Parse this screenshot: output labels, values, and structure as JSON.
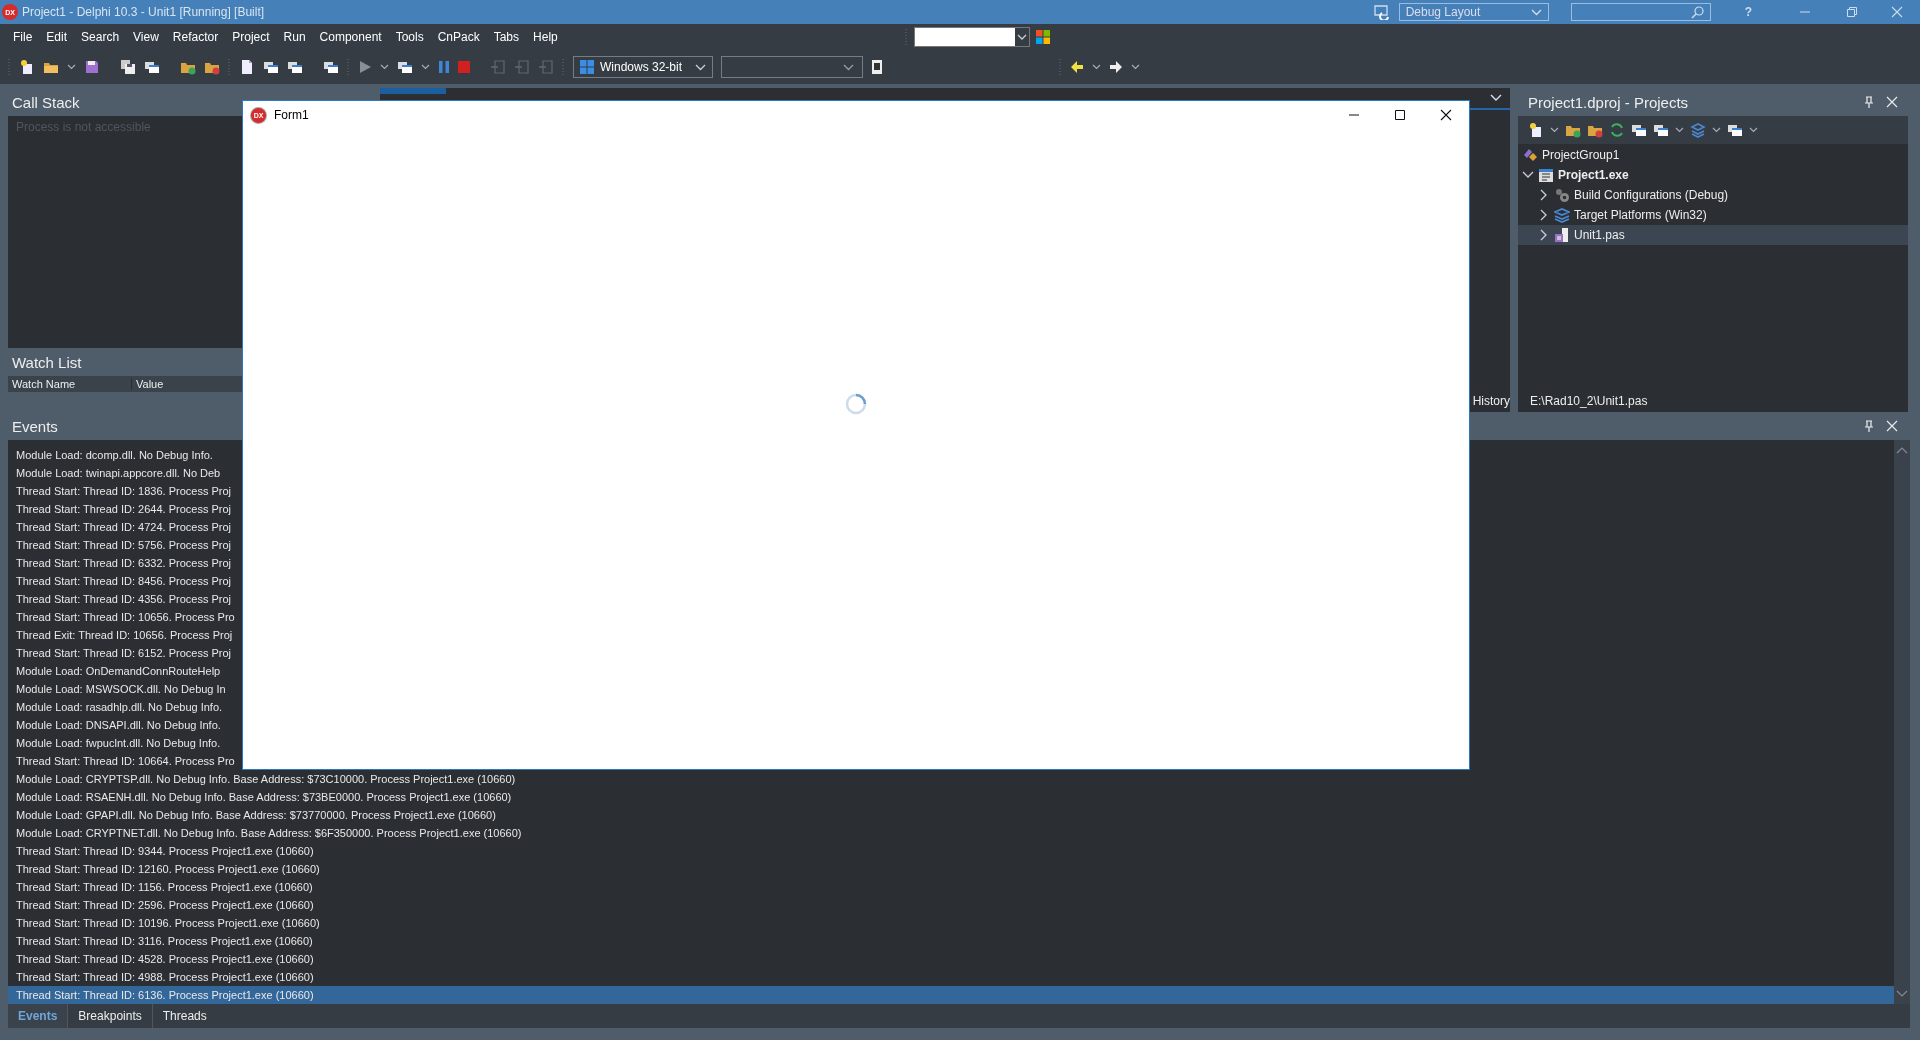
{
  "title_bar": {
    "logo": "DX",
    "title": "Project1 - Delphi 10.3 - Unit1 [Running] [Built]",
    "layout": "Debug Layout",
    "help": "?"
  },
  "menu": [
    "File",
    "Edit",
    "Search",
    "View",
    "Refactor",
    "Project",
    "Run",
    "Component",
    "Tools",
    "CnPack",
    "Tabs",
    "Help"
  ],
  "toolbar": {
    "platform": "Windows 32-bit"
  },
  "call_stack": {
    "title": "Call Stack",
    "message": "Process is not accessible"
  },
  "watch_list": {
    "title": "Watch List",
    "columns": [
      "Watch Name",
      "Value"
    ]
  },
  "editor": {
    "history_tab": "History"
  },
  "projects": {
    "title": "Project1.dproj - Projects",
    "tree": [
      {
        "label": "ProjectGroup1",
        "kind": "group",
        "selected": false,
        "children": [
          {
            "label": "Project1.exe",
            "kind": "project",
            "expanded": true,
            "selected": false,
            "children": [
              {
                "label": "Build Configurations (Debug)",
                "kind": "config",
                "expanded": false,
                "selected": false
              },
              {
                "label": "Target Platforms (Win32)",
                "kind": "platforms",
                "expanded": false,
                "selected": false
              },
              {
                "label": "Unit1.pas",
                "kind": "unit",
                "expanded": false,
                "selected": true
              }
            ]
          }
        ]
      }
    ],
    "path": "E:\\Rad10_2\\Unit1.pas"
  },
  "events": {
    "title": "Events",
    "rows": [
      {
        "text": "Module Load: dcomp.dll. No Debug Info.",
        "selected": false
      },
      {
        "text": "Module Load: twinapi.appcore.dll. No Deb",
        "selected": false
      },
      {
        "text": "Thread Start: Thread ID: 1836. Process Proj",
        "selected": false
      },
      {
        "text": "Thread Start: Thread ID: 2644. Process Proj",
        "selected": false
      },
      {
        "text": "Thread Start: Thread ID: 4724. Process Proj",
        "selected": false
      },
      {
        "text": "Thread Start: Thread ID: 5756. Process Proj",
        "selected": false
      },
      {
        "text": "Thread Start: Thread ID: 6332. Process Proj",
        "selected": false
      },
      {
        "text": "Thread Start: Thread ID: 8456. Process Proj",
        "selected": false
      },
      {
        "text": "Thread Start: Thread ID: 4356. Process Proj",
        "selected": false
      },
      {
        "text": "Thread Start: Thread ID: 10656. Process Pro",
        "selected": false
      },
      {
        "text": "Thread Exit: Thread ID: 10656. Process Proj",
        "selected": false
      },
      {
        "text": "Thread Start: Thread ID: 6152. Process Proj",
        "selected": false
      },
      {
        "text": "Module Load: OnDemandConnRouteHelp",
        "selected": false
      },
      {
        "text": "Module Load: MSWSOCK.dll. No Debug In",
        "selected": false
      },
      {
        "text": "Module Load: rasadhlp.dll. No Debug Info.",
        "selected": false
      },
      {
        "text": "Module Load: DNSAPI.dll. No Debug Info.",
        "selected": false
      },
      {
        "text": "Module Load: fwpuclnt.dll. No Debug Info.",
        "selected": false
      },
      {
        "text": "Thread Start: Thread ID: 10664. Process Pro",
        "selected": false
      },
      {
        "text": "Module Load: CRYPTSP.dll. No Debug Info. Base Address: $73C10000. Process Project1.exe (10660)",
        "selected": false
      },
      {
        "text": "Module Load: RSAENH.dll. No Debug Info. Base Address: $73BE0000. Process Project1.exe (10660)",
        "selected": false
      },
      {
        "text": "Module Load: GPAPI.dll. No Debug Info. Base Address: $73770000. Process Project1.exe (10660)",
        "selected": false
      },
      {
        "text": "Module Load: CRYPTNET.dll. No Debug Info. Base Address: $6F350000. Process Project1.exe (10660)",
        "selected": false
      },
      {
        "text": "Thread Start: Thread ID: 9344. Process Project1.exe (10660)",
        "selected": false
      },
      {
        "text": "Thread Start: Thread ID: 12160. Process Project1.exe (10660)",
        "selected": false
      },
      {
        "text": "Thread Start: Thread ID: 1156. Process Project1.exe (10660)",
        "selected": false
      },
      {
        "text": "Thread Start: Thread ID: 2596. Process Project1.exe (10660)",
        "selected": false
      },
      {
        "text": "Thread Start: Thread ID: 10196. Process Project1.exe (10660)",
        "selected": false
      },
      {
        "text": "Thread Start: Thread ID: 3116. Process Project1.exe (10660)",
        "selected": false
      },
      {
        "text": "Thread Start: Thread ID: 4528. Process Project1.exe (10660)",
        "selected": false
      },
      {
        "text": "Thread Start: Thread ID: 4988. Process Project1.exe (10660)",
        "selected": false
      },
      {
        "text": "Thread Start: Thread ID: 6136. Process Project1.exe (10660)",
        "selected": true
      }
    ],
    "tabs": [
      {
        "label": "Events",
        "selected": true
      },
      {
        "label": "Breakpoints",
        "selected": false
      },
      {
        "label": "Threads",
        "selected": false
      }
    ]
  },
  "form": {
    "logo": "DX",
    "title": "Form1"
  }
}
